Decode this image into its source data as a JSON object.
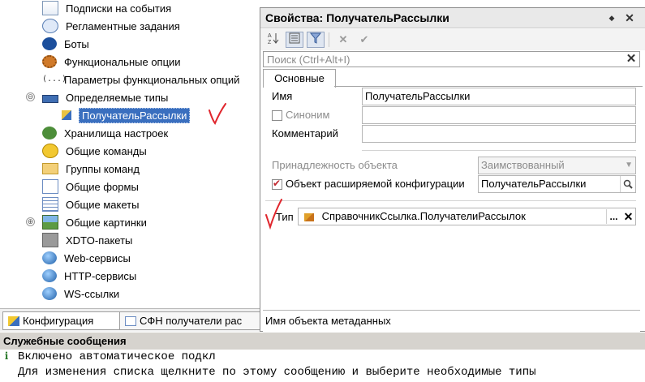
{
  "tree": {
    "items": [
      {
        "label": "Подписки на события",
        "icon": "event-subscription-icon"
      },
      {
        "label": "Регламентные задания",
        "icon": "scheduled-job-icon"
      },
      {
        "label": "Боты",
        "icon": "bot-icon"
      },
      {
        "label": "Функциональные опции",
        "icon": "functional-option-icon"
      },
      {
        "label": "Параметры функциональных опций",
        "icon": "functional-option-params-icon"
      },
      {
        "label": "Определяемые типы",
        "icon": "defined-types-icon"
      },
      {
        "label": "ПолучательРассылки",
        "icon": "defined-type-item-icon"
      },
      {
        "label": "Хранилища настроек",
        "icon": "settings-storage-icon"
      },
      {
        "label": "Общие команды",
        "icon": "common-command-icon"
      },
      {
        "label": "Группы команд",
        "icon": "command-group-icon"
      },
      {
        "label": "Общие формы",
        "icon": "common-form-icon"
      },
      {
        "label": "Общие макеты",
        "icon": "common-template-icon"
      },
      {
        "label": "Общие картинки",
        "icon": "common-picture-icon"
      },
      {
        "label": "XDTO-пакеты",
        "icon": "xdto-package-icon"
      },
      {
        "label": "Web-сервисы",
        "icon": "web-service-icon"
      },
      {
        "label": "HTTP-сервисы",
        "icon": "http-service-icon"
      },
      {
        "label": "WS-ссылки",
        "icon": "ws-reference-icon"
      }
    ],
    "expanded_marker": "⊖",
    "collapsed_marker": "⊕"
  },
  "bottom_tabs": {
    "configuration": "Конфигурация",
    "second": "СФН получатели рас"
  },
  "messages": {
    "header": "Служебные сообщения",
    "lines": [
      "Включено автоматическое подкл",
      "Для изменения списка щелкните по этому сообщению и выберите необходимые типы"
    ],
    "info_icon": "i"
  },
  "properties": {
    "title": "Свойства: ПолучательРассылки",
    "pin_icon": "◆",
    "close_icon": "✕",
    "search_placeholder": "Поиск (Ctrl+Alt+I)",
    "tab_main": "Основные",
    "name_label": "Имя",
    "name_value": "ПолучательРассылки",
    "synonym_label": "Синоним",
    "synonym_value": "",
    "comment_label": "Комментарий",
    "comment_value": "",
    "belonging_label": "Принадлежность объекта",
    "belonging_value": "Заимствованный",
    "extension_label": "Объект расширяемой конфигурации",
    "extension_value": "ПолучательРассылки",
    "extension_checked": true,
    "type_label": "Тип",
    "type_value": "СправочникСсылка.ПолучателиРассылок",
    "description": "Имя объекта метаданных",
    "ellipsis": "...",
    "clear_glyph": "✕"
  },
  "colors": {
    "selection": "#3a6fbf",
    "check_mark": "#e0262d"
  }
}
